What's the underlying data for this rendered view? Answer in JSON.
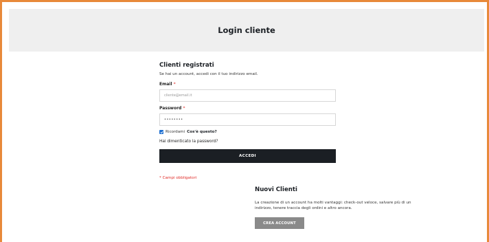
{
  "page": {
    "title": "Login cliente",
    "accent_color": "#e8893a"
  },
  "registered": {
    "title": "Clienti registrati",
    "intro": "Se hai un account, accedi con il tuo indirizzo email.",
    "email_label": "Email",
    "email_placeholder": "cliente@email.it",
    "password_label": "Password",
    "password_value": "••••••••",
    "required_mark": "*",
    "remember_label": "Ricordami",
    "remember_checked": true,
    "whats_this": "Cos'è questo?",
    "forgot_link": "Hai dimenticato la password?",
    "login_button": "ACCEDI",
    "required_note": "* Campi obbligatori"
  },
  "new_customers": {
    "title": "Nuovi Clienti",
    "description": "La creazione di un account ha molti vantaggi: check-out veloce, salvare più di un indirizzo, tenere traccia degli ordini e altro ancora.",
    "create_button": "CREA ACCOUNT"
  }
}
